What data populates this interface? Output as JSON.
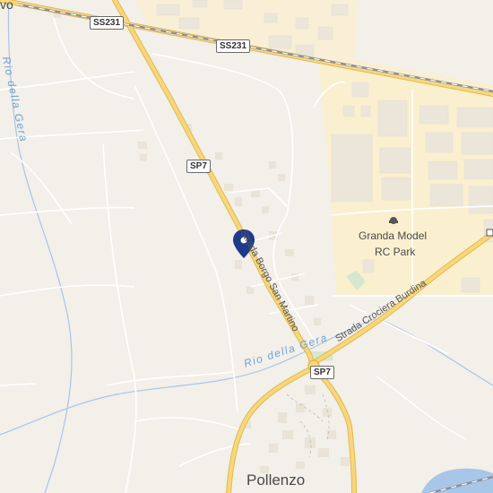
{
  "map": {
    "labels": {
      "town_partial": "vo",
      "town": "Pollenzo",
      "poi_line1": "Granda Model",
      "poi_line2": "RC Park"
    },
    "road_names": {
      "borgo": "Strada Borgo San Martino",
      "crociera": "Strada Crociera Burdina"
    },
    "shields": {
      "ss231_a": "SS231",
      "ss231_b": "SS231",
      "sp7_a": "SP7",
      "sp7_b": "SP7"
    },
    "rivers": {
      "gera_vertical": "Rio della Gera",
      "gera_horizontal": "Rio della Gera"
    },
    "icons": {
      "pin": "location-pin-icon",
      "poi": "rc-park-icon"
    },
    "colors": {
      "background": "#f3efe9",
      "industrial": "#faf0cf",
      "building": "#ece6da",
      "main_road": "#f2cd6e",
      "railway": "#9a9aa8",
      "water": "#a8c6e8",
      "pin": "#1e3a8a"
    }
  }
}
